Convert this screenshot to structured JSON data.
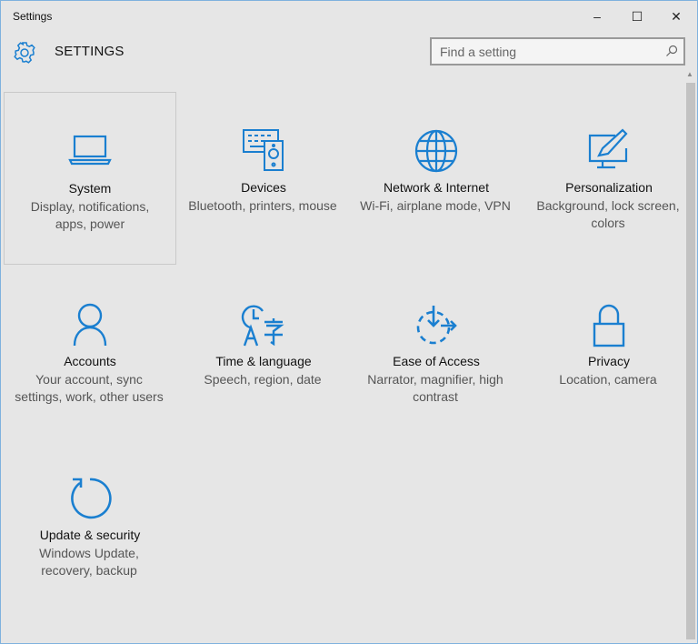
{
  "window": {
    "title": "Settings",
    "minimize": "–",
    "maximize": "☐",
    "close": "✕"
  },
  "header": {
    "title": "SETTINGS",
    "search_placeholder": "Find a setting"
  },
  "tiles": [
    {
      "name": "System",
      "desc": "Display, notifications, apps, power",
      "icon": "laptop-icon"
    },
    {
      "name": "Devices",
      "desc": "Bluetooth, printers, mouse",
      "icon": "devices-icon"
    },
    {
      "name": "Network & Internet",
      "desc": "Wi-Fi, airplane mode, VPN",
      "icon": "globe-icon"
    },
    {
      "name": "Personalization",
      "desc": "Background, lock screen, colors",
      "icon": "paint-icon"
    },
    {
      "name": "Accounts",
      "desc": "Your account, sync settings, work, other users",
      "icon": "person-icon"
    },
    {
      "name": "Time & language",
      "desc": "Speech, region, date",
      "icon": "time-language-icon"
    },
    {
      "name": "Ease of Access",
      "desc": "Narrator, magnifier, high contrast",
      "icon": "ease-of-access-icon"
    },
    {
      "name": "Privacy",
      "desc": "Location, camera",
      "icon": "lock-icon"
    },
    {
      "name": "Update & security",
      "desc": "Windows Update, recovery, backup",
      "icon": "refresh-icon"
    }
  ],
  "colors": {
    "accent": "#1a7fd0"
  }
}
